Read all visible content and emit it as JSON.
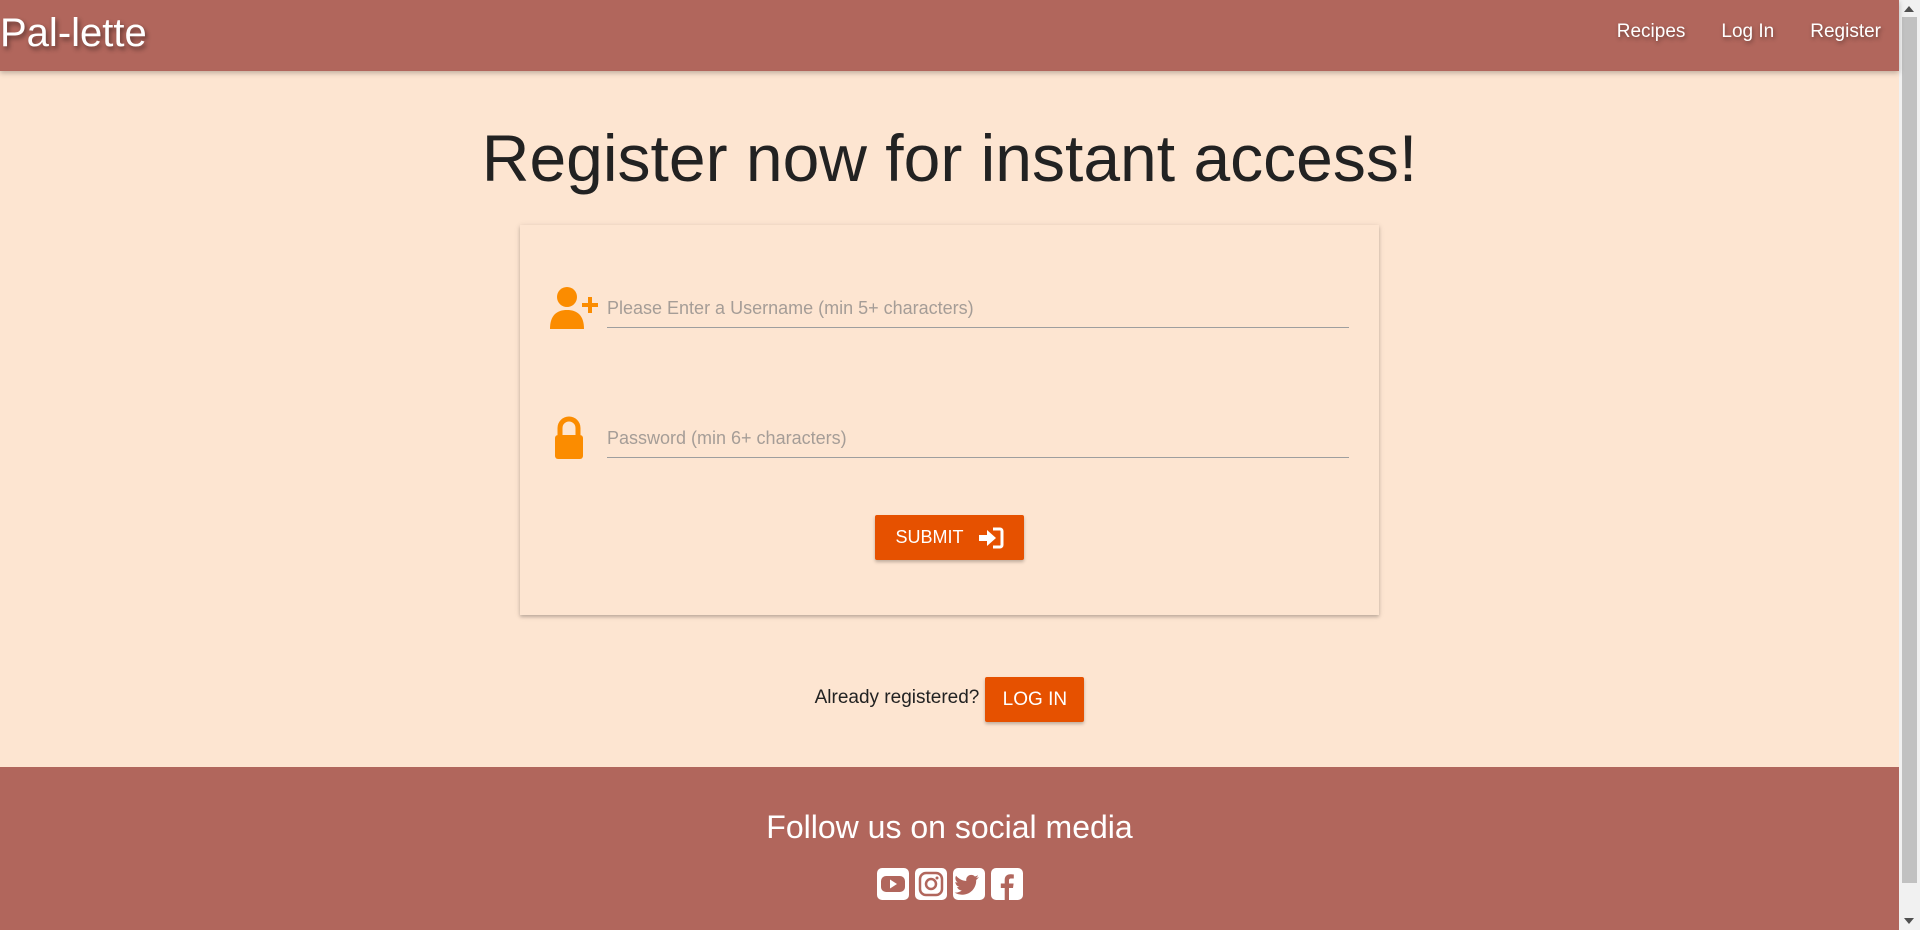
{
  "brand": "Pal-lette",
  "nav": {
    "recipes": "Recipes",
    "login": "Log In",
    "register": "Register"
  },
  "main": {
    "heading": "Register now for instant access!",
    "username_placeholder": "Please Enter a Username (min 5+ characters)",
    "password_placeholder": "Password (min 6+ characters)",
    "submit_label": "SUBMIT",
    "already_text": "Already registered?",
    "login_button": "LOG IN"
  },
  "footer": {
    "title": "Follow us on social media",
    "socials": [
      "youtube-icon",
      "instagram-icon",
      "twitter-icon",
      "facebook-icon"
    ]
  },
  "colors": {
    "navbar": "#b1665c",
    "background": "#fde5d1",
    "accent": "#e65100",
    "icon_orange": "#fb8c00"
  },
  "icons": {
    "username": "user-plus-icon",
    "password": "lock-icon",
    "submit": "sign-in-icon"
  }
}
